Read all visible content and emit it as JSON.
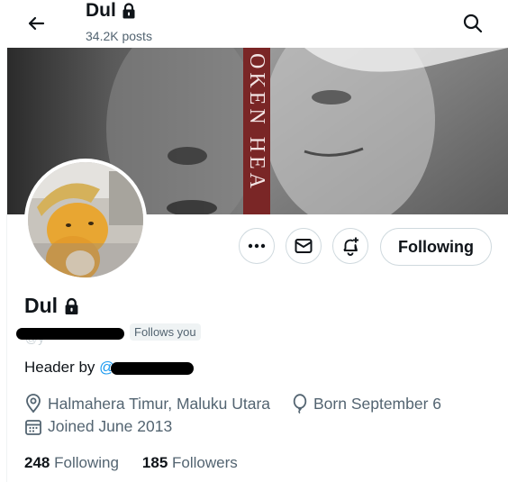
{
  "header": {
    "title": "Dul",
    "posts": "34.2K posts"
  },
  "banner": {
    "text": "OKEN HEA"
  },
  "actions": {
    "follow_label": "Following"
  },
  "profile": {
    "name": "Dul",
    "handle_visible": "@y",
    "follows_you": "Follows you",
    "bio_prefix": "Header by",
    "bio_mention": "@",
    "location": "Halmahera Timur, Maluku Utara",
    "birthday": "Born September 6",
    "joined": "Joined June 2013"
  },
  "stats": {
    "following_count": "248",
    "following_label": "Following",
    "followers_count": "185",
    "followers_label": "Followers"
  },
  "colors": {
    "accent": "#1d9bf0",
    "secondary_text": "#536471",
    "border": "#cfd9de"
  },
  "icons": [
    "back-arrow-icon",
    "lock-icon",
    "search-icon",
    "more-icon",
    "mail-icon",
    "notification-bell-icon",
    "location-icon",
    "balloon-icon",
    "calendar-icon"
  ]
}
